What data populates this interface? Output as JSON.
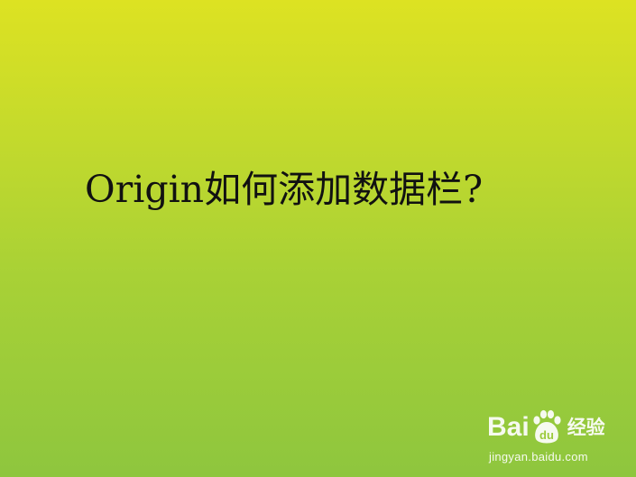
{
  "slide": {
    "title": "Origin如何添加数据栏?",
    "background_colors": [
      "#dde222",
      "#8ec63e"
    ],
    "text_color": "#111111"
  },
  "watermark": {
    "logo_left": "Bai",
    "logo_right": "经验",
    "logo_icon": "paw-du-icon",
    "url": "jingyan.baidu.com",
    "color": "#ffffff"
  }
}
